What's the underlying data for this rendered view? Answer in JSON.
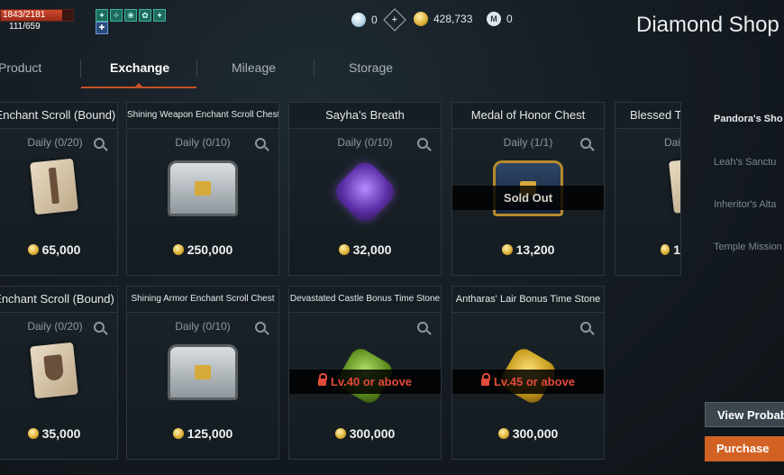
{
  "status": {
    "hp": "1843/2181",
    "hp_fraction": 0.845,
    "mp": "111/659"
  },
  "currency": {
    "diamond": "0",
    "adena": "428,733",
    "mileage": "0"
  },
  "page": {
    "title": "Diamond Shop"
  },
  "tabs": [
    {
      "label": "Product"
    },
    {
      "label": "Exchange"
    },
    {
      "label": "Mileage"
    },
    {
      "label": "Storage"
    }
  ],
  "cards": [
    {
      "title": "n Enchant Scroll (Bound)",
      "daily": "Daily (0/20)",
      "price": "65,000"
    },
    {
      "title": "Shining Weapon Enchant Scroll Chest",
      "daily": "Daily (0/10)",
      "price": "250,000"
    },
    {
      "title": "Sayha's Breath",
      "daily": "Daily (0/10)",
      "price": "32,000"
    },
    {
      "title": "Medal of Honor Chest",
      "daily": "Daily (1/1)",
      "price": "13,200",
      "overlay": "Sold Out"
    },
    {
      "title": "Blessed T",
      "daily": "Dail",
      "price": "1"
    },
    {
      "title": "Enchant Scroll (Bound)",
      "daily": "Daily (0/20)",
      "price": "35,000"
    },
    {
      "title": "Shining Armor Enchant Scroll Chest",
      "daily": "Daily (0/10)",
      "price": "125,000"
    },
    {
      "title": "Devastated Castle Bonus Time Stone",
      "price": "300,000",
      "overlay": "Lv.40 or above"
    },
    {
      "title": "Antharas' Lair Bonus Time Stone",
      "price": "300,000",
      "overlay": "Lv.45 or above"
    }
  ],
  "side_menu": [
    {
      "label": "Pandora's Sho"
    },
    {
      "label": "Leah's Sanctu"
    },
    {
      "label": "Inheritor's Alta"
    },
    {
      "label": "Temple Mission"
    }
  ],
  "buttons": {
    "view_probability": "View Probab",
    "purchase": "Purchase"
  }
}
